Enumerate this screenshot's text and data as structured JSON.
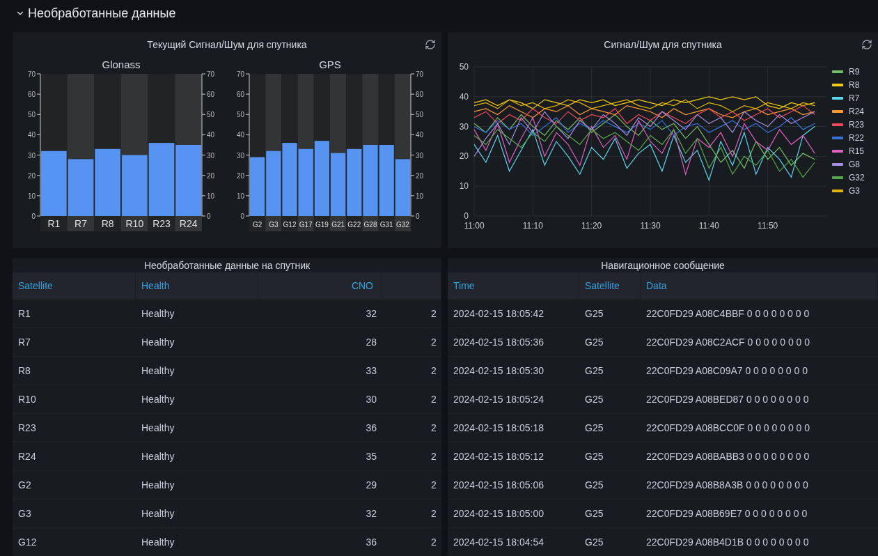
{
  "section": {
    "title": "Необработанные данные",
    "expanded": true
  },
  "bar_panel": {
    "title": "Текущий Сигнал/Шум для спутника",
    "charts": [
      {
        "chart_data": {
          "type": "bar",
          "title": "Glonass",
          "categories": [
            "R1",
            "R7",
            "R8",
            "R10",
            "R23",
            "R24"
          ],
          "values": [
            32,
            28,
            33,
            30,
            36,
            35
          ],
          "ylim": [
            0,
            70
          ],
          "yticks": [
            0,
            10,
            20,
            30,
            40,
            50,
            60,
            70
          ]
        },
        "right_axis_ticks": [
          "70",
          "60",
          "50",
          "40",
          "30",
          "20",
          "10",
          "0"
        ]
      },
      {
        "chart_data": {
          "type": "bar",
          "title": "GPS",
          "categories": [
            "G2",
            "G3",
            "G12",
            "G17",
            "G19",
            "G21",
            "G22",
            "G28",
            "G31",
            "G32"
          ],
          "values": [
            29,
            32,
            36,
            33,
            37,
            31,
            33,
            35,
            35,
            28
          ],
          "ylim": [
            0,
            70
          ],
          "yticks": [
            0,
            10,
            20,
            30,
            40,
            50,
            60,
            70
          ]
        },
        "right_axis_ticks": [
          "70",
          "60",
          "50",
          "40",
          "30",
          "20",
          "10",
          "0"
        ]
      }
    ]
  },
  "line_panel": {
    "title": "Сигнал/Шум для спутника",
    "chart_data": {
      "type": "line",
      "ylim": [
        0,
        50
      ],
      "grid": true,
      "yticks": [
        0,
        10,
        20,
        30,
        40,
        50
      ],
      "categories": [
        "11:00",
        null,
        null,
        null,
        null,
        "11:10",
        null,
        null,
        null,
        null,
        "11:20",
        null,
        null,
        null,
        null,
        "11:30",
        null,
        null,
        null,
        null,
        "11:40",
        null,
        null,
        null,
        null,
        "11:50",
        null,
        null,
        null,
        null
      ],
      "series": [
        {
          "name": "R9",
          "color": "#73bf69",
          "values": [
            31,
            28,
            33,
            29,
            34,
            30,
            27,
            32,
            29,
            33,
            28,
            31,
            34,
            30,
            27,
            32,
            29,
            31,
            26,
            30,
            24,
            18,
            22,
            16,
            25,
            19,
            23,
            17,
            21,
            19
          ]
        },
        {
          "name": "R8",
          "color": "#f2cc0c",
          "values": [
            38,
            39,
            37,
            39,
            38,
            36,
            39,
            38,
            37,
            39,
            38,
            39,
            37,
            38,
            39,
            38,
            37,
            39,
            38,
            39,
            40,
            39,
            40,
            39,
            40,
            37,
            36,
            38,
            37,
            38
          ]
        },
        {
          "name": "R7",
          "color": "#5ad8f0",
          "values": [
            24,
            18,
            27,
            15,
            22,
            29,
            17,
            25,
            20,
            14,
            23,
            19,
            26,
            16,
            21,
            24,
            15,
            27,
            18,
            22,
            12,
            25,
            17,
            28,
            14,
            23,
            19,
            13,
            27,
            30
          ]
        },
        {
          "name": "R24",
          "color": "#ff9830",
          "values": [
            35,
            36,
            34,
            37,
            35,
            33,
            36,
            35,
            37,
            34,
            36,
            35,
            34,
            37,
            36,
            35,
            33,
            36,
            34,
            35,
            36,
            34,
            33,
            35,
            36,
            34,
            35,
            36,
            34,
            35
          ]
        },
        {
          "name": "R23",
          "color": "#f2495c",
          "values": [
            33,
            35,
            31,
            34,
            32,
            36,
            33,
            31,
            35,
            32,
            34,
            33,
            36,
            31,
            34,
            32,
            35,
            33,
            31,
            34,
            36,
            33,
            35,
            32,
            34,
            36,
            33,
            35,
            37,
            34
          ]
        },
        {
          "name": "R22",
          "color": "#3274d9",
          "values": [
            30,
            28,
            32,
            29,
            31,
            27,
            30,
            33,
            28,
            31,
            29,
            32,
            30,
            28,
            31,
            29,
            32,
            27,
            30,
            31,
            28,
            30,
            32,
            29,
            31,
            28,
            30,
            33,
            29,
            31
          ]
        },
        {
          "name": "R15",
          "color": "#e05fc0",
          "values": [
            29,
            22,
            31,
            18,
            26,
            33,
            20,
            28,
            24,
            17,
            30,
            23,
            27,
            19,
            32,
            25,
            21,
            29,
            14,
            26,
            23,
            28,
            20,
            31,
            25,
            22,
            29,
            24,
            27,
            21
          ]
        },
        {
          "name": "G8",
          "color": "#a58ee0",
          "values": [
            20,
            26,
            31,
            24,
            33,
            28,
            35,
            30,
            26,
            32,
            29,
            34,
            31,
            27,
            33,
            30,
            35,
            32,
            29,
            34,
            31,
            33,
            28,
            35,
            32,
            30,
            34,
            31,
            33,
            35
          ]
        },
        {
          "name": "G32",
          "color": "#56a64b",
          "values": [
            27,
            24,
            29,
            26,
            23,
            28,
            25,
            30,
            27,
            24,
            29,
            26,
            28,
            25,
            22,
            27,
            24,
            29,
            21,
            26,
            16,
            23,
            14,
            20,
            17,
            22,
            15,
            19,
            13,
            18
          ]
        },
        {
          "name": "G3",
          "color": "#e0b400",
          "values": [
            37,
            38,
            36,
            39,
            37,
            38,
            36,
            37,
            39,
            38,
            36,
            37,
            38,
            39,
            37,
            36,
            38,
            37,
            39,
            36,
            38,
            37,
            35,
            37,
            36,
            38,
            37,
            36,
            38,
            37
          ]
        }
      ]
    }
  },
  "raw_table": {
    "title": "Необработанные данные на спутник",
    "columns": [
      "Satellite",
      "Health",
      "CNO"
    ],
    "rows": [
      [
        "R1",
        "Healthy",
        "32",
        "2"
      ],
      [
        "R7",
        "Healthy",
        "28",
        "2"
      ],
      [
        "R8",
        "Healthy",
        "33",
        "2"
      ],
      [
        "R10",
        "Healthy",
        "30",
        "2"
      ],
      [
        "R23",
        "Healthy",
        "36",
        "2"
      ],
      [
        "R24",
        "Healthy",
        "35",
        "2"
      ],
      [
        "G2",
        "Healthy",
        "29",
        "2"
      ],
      [
        "G3",
        "Healthy",
        "32",
        "2"
      ],
      [
        "G12",
        "Healthy",
        "36",
        "2"
      ]
    ]
  },
  "nav_table": {
    "title": "Навигационное сообщение",
    "columns": [
      "Time",
      "Satellite",
      "Data"
    ],
    "rows": [
      [
        "2024-02-15 18:05:42",
        "G25",
        "22C0FD29 A08C4BBF 0 0 0 0 0 0 0 0"
      ],
      [
        "2024-02-15 18:05:36",
        "G25",
        "22C0FD29 A08C2ACF 0 0 0 0 0 0 0 0"
      ],
      [
        "2024-02-15 18:05:30",
        "G25",
        "22C0FD29 A08C09A7 0 0 0 0 0 0 0 0"
      ],
      [
        "2024-02-15 18:05:24",
        "G25",
        "22C0FD29 A08BED87 0 0 0 0 0 0 0 0"
      ],
      [
        "2024-02-15 18:05:18",
        "G25",
        "22C0FD29 A08BCC0F 0 0 0 0 0 0 0 0"
      ],
      [
        "2024-02-15 18:05:12",
        "G25",
        "22C0FD29 A08BABB3 0 0 0 0 0 0 0 0"
      ],
      [
        "2024-02-15 18:05:06",
        "G25",
        "22C0FD29 A08B8A3B 0 0 0 0 0 0 0 0"
      ],
      [
        "2024-02-15 18:05:00",
        "G25",
        "22C0FD29 A08B69E7 0 0 0 0 0 0 0 0"
      ],
      [
        "2024-02-15 18:04:54",
        "G25",
        "22C0FD29 A08B4D1B 0 0 0 0 0 0 0 0"
      ]
    ]
  }
}
